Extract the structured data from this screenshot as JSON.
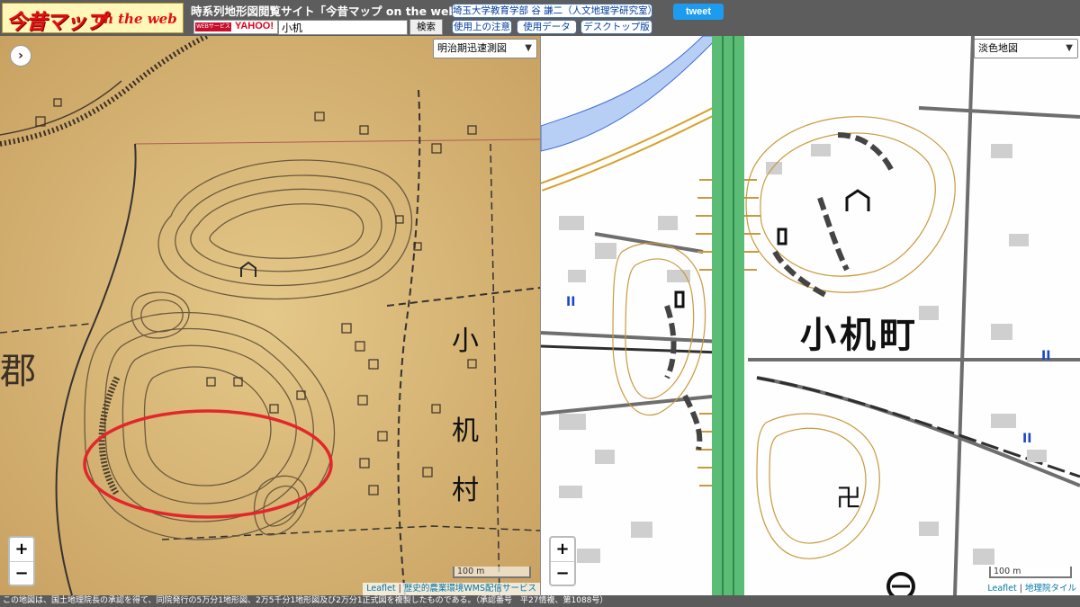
{
  "header": {
    "logo_main": "今昔マップ",
    "logo_sub": "on the web",
    "site_title": "時系列地形図閲覧サイト「今昔マップ on the web」",
    "search_badge_left": "WEBサービス",
    "search_badge_right": "YAHOO!",
    "search_value": "小机",
    "search_button": "検索",
    "author_button": "埼玉大学教育学部 谷 謙二（人文地理学研究室）",
    "caution_button": "使用上の注意",
    "data_button": "使用データ",
    "desktop_button": "デスクトップ版",
    "tweet_button": "tweet"
  },
  "left_map": {
    "layer_select": "明治期迅速測図",
    "expand_icon": "›",
    "zoom_in": "+",
    "zoom_out": "−",
    "scale": "100 m",
    "attribution_leaflet": "Leaflet",
    "attribution_source": "歴史的農業環境WMS配信サービス",
    "labels": [
      "小",
      "机",
      "村",
      "郡"
    ]
  },
  "right_map": {
    "layer_select": "淡色地図",
    "zoom_in": "+",
    "zoom_out": "−",
    "scale": "100 m",
    "attribution_leaflet": "Leaflet",
    "attribution_source": "地理院タイル",
    "town_label": "小机町",
    "temple_symbol": "卍",
    "rail_symbol": "II"
  },
  "footer": {
    "text": "この地図は、国土地理院長の承認を得て、同院発行の5万分1地形図、2万5千分1地形図及び2万分1正式図を複製したものである。（承認番号　平27情複、第1088号）"
  },
  "colors": {
    "old_map_paper": "#ddbd7f",
    "highlight_circle": "#e3262b",
    "river": "#b7cff5",
    "railway_green": "#5bbd75",
    "contour": "#c99a3c"
  }
}
